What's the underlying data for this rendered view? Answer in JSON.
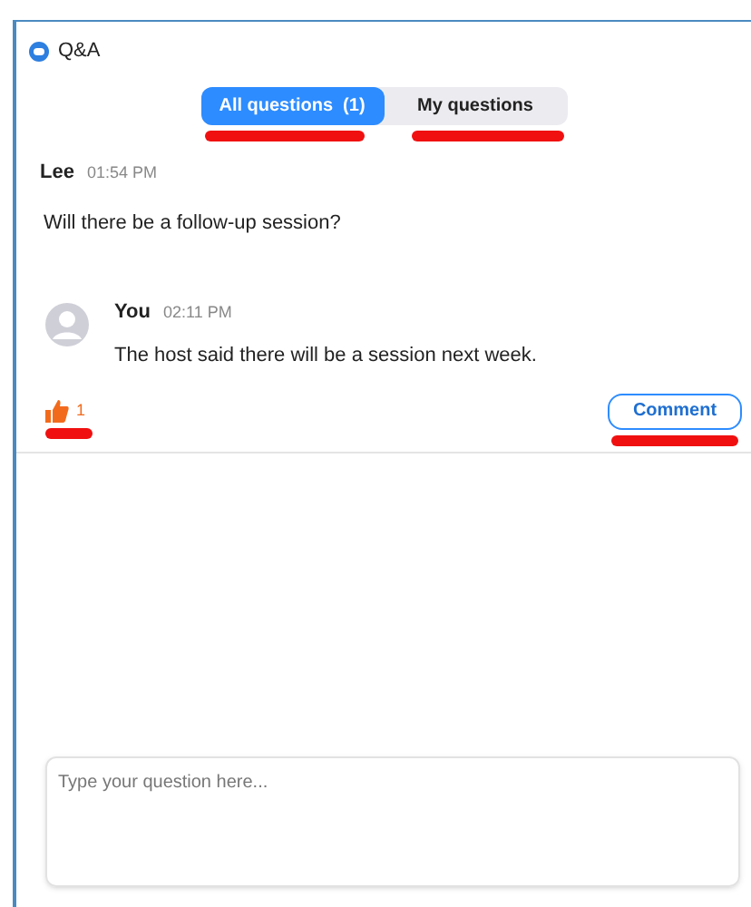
{
  "window": {
    "title": "Q&A"
  },
  "tabs": [
    {
      "label": "All questions  (1)",
      "selected": true
    },
    {
      "label": "My questions",
      "selected": false
    }
  ],
  "question": {
    "author": "Lee",
    "time": "01:54 PM",
    "text": "Will there be a follow-up session?",
    "answer": {
      "author": "You",
      "time": "02:11 PM",
      "text": "The host said there will be a session next week."
    },
    "likes": "1",
    "comment_button": "Comment"
  },
  "input": {
    "placeholder": "Type your question here..."
  }
}
